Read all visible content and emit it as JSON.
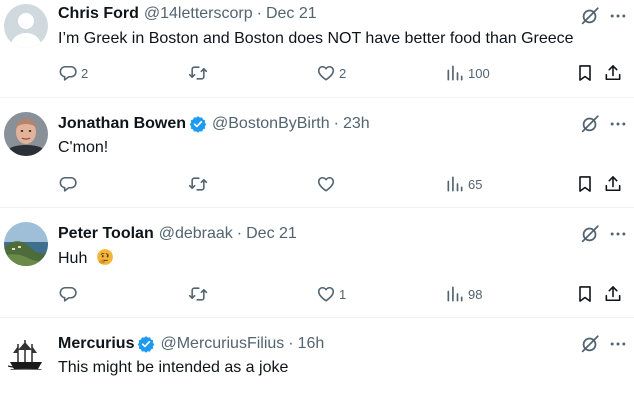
{
  "posts": [
    {
      "name": "Chris Ford",
      "verified": false,
      "handle": "@14letterscorp",
      "dot": "·",
      "time": "Dec 21",
      "text": "I’m Greek in Boston and Boston does NOT have better food than Greece",
      "emoji": "",
      "replies": "2",
      "reposts": "",
      "likes": "2",
      "views": "100",
      "avatar": "default-avatar-icon"
    },
    {
      "name": "Jonathan Bowen",
      "verified": true,
      "handle": "@BostonByBirth",
      "dot": "·",
      "time": "23h",
      "text": "C'mon!",
      "emoji": "",
      "replies": "",
      "reposts": "",
      "likes": "",
      "views": "65",
      "avatar": "profile-photo"
    },
    {
      "name": "Peter Toolan",
      "verified": false,
      "handle": "@debraak",
      "dot": "·",
      "time": "Dec 21",
      "text": "Huh",
      "emoji": "thinking-face",
      "replies": "",
      "reposts": "",
      "likes": "1",
      "views": "98",
      "avatar": "landscape-photo"
    },
    {
      "name": "Mercurius",
      "verified": true,
      "handle": "@MercuriusFilius",
      "dot": "·",
      "time": "16h",
      "text": "This might be intended as a joke",
      "emoji": "",
      "avatar": "ship-silhouette-image"
    }
  ],
  "colors": {
    "text": "#0f1419",
    "secondary": "#536471",
    "verified_blue": "#1d9bf0",
    "divider": "#eff3f4"
  },
  "icons": [
    "reply-icon",
    "repost-icon",
    "like-icon",
    "views-icon",
    "bookmark-icon",
    "share-icon",
    "grok-icon",
    "more-icon",
    "verified-badge-icon"
  ]
}
